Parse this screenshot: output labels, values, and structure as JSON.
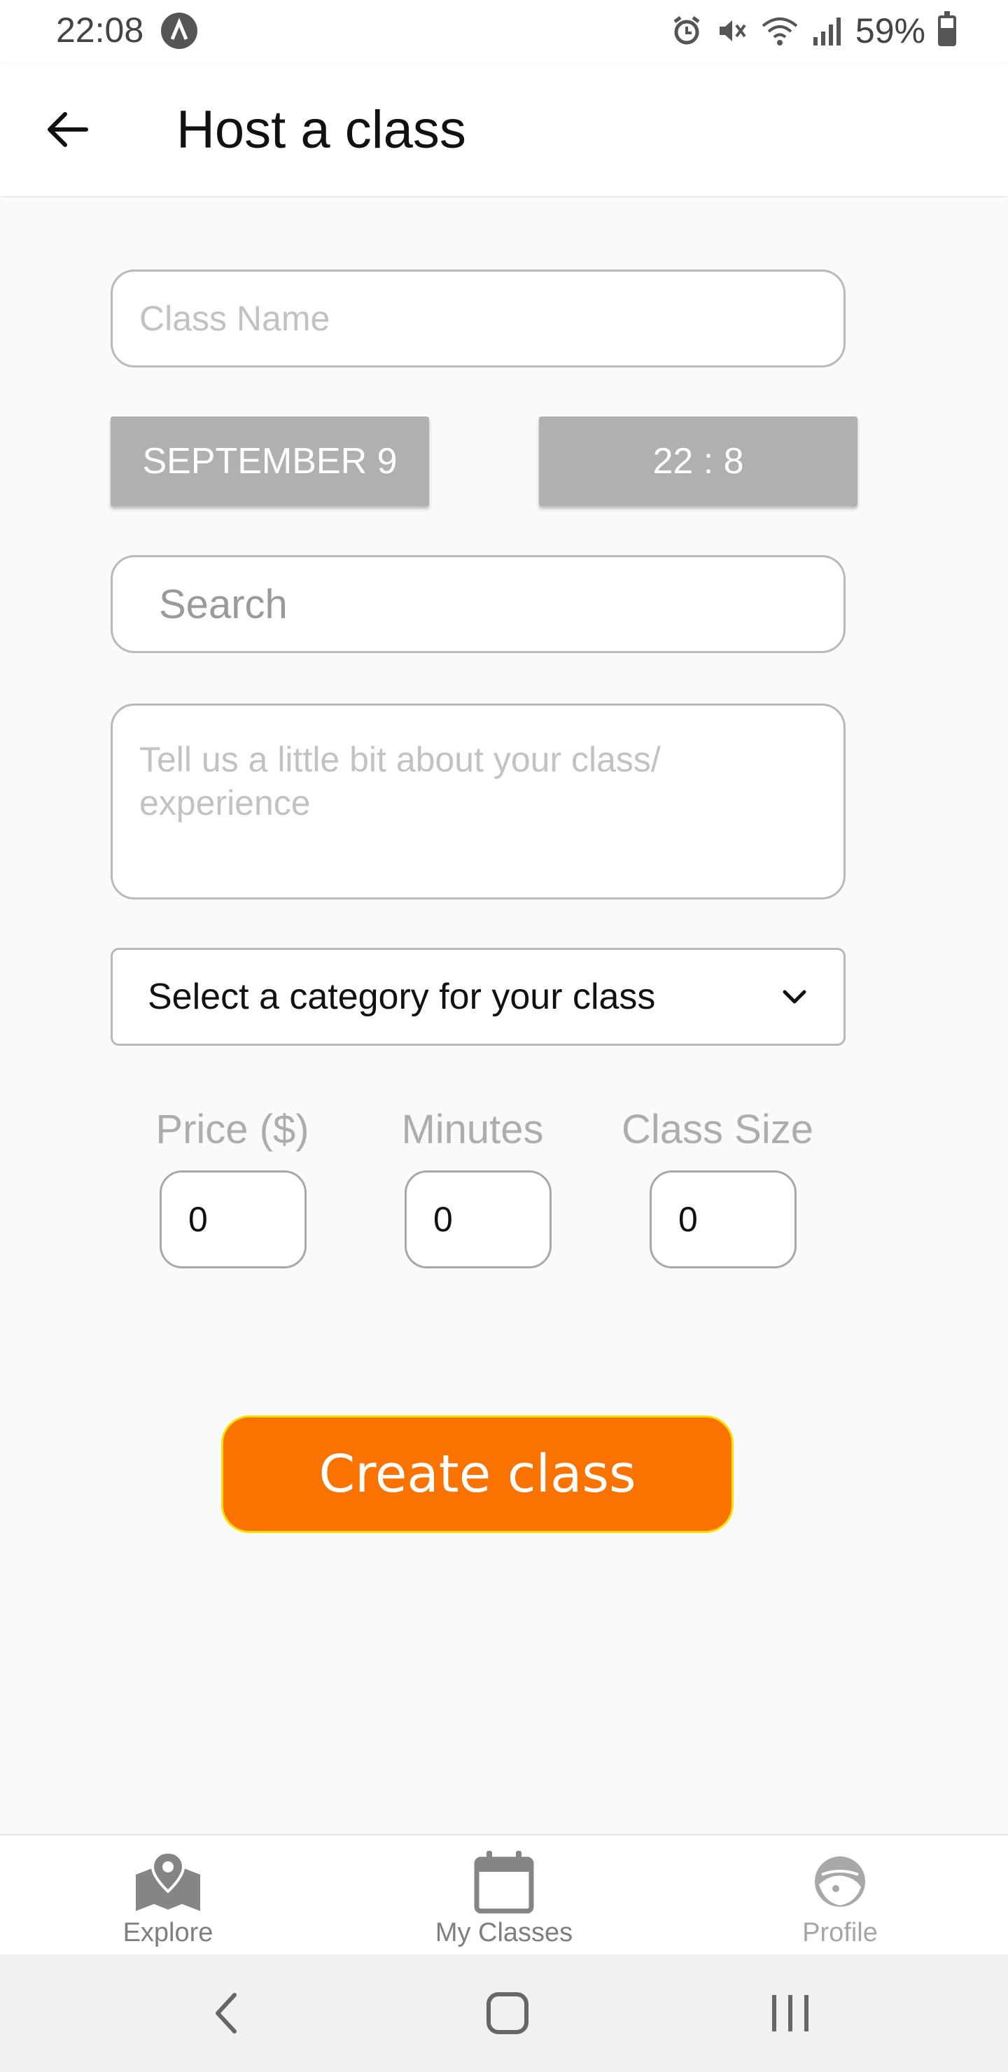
{
  "status_bar": {
    "time": "22:08",
    "battery": "59%"
  },
  "header": {
    "title": "Host a class"
  },
  "form": {
    "class_name_placeholder": "Class Name",
    "date_label": "SEPTEMBER 9",
    "time_label": "22 : 8",
    "search_placeholder": "Search",
    "about_placeholder": "Tell us a little bit about your class/ experience",
    "category_label": "Select a category for your class",
    "price_label": "Price ($)",
    "price_value": "0",
    "minutes_label": "Minutes",
    "minutes_value": "0",
    "size_label": "Class Size",
    "size_value": "0",
    "submit_label": "Create class"
  },
  "tabs": [
    {
      "label": "Explore",
      "icon": "map-pin-icon"
    },
    {
      "label": "My Classes",
      "icon": "calendar-icon"
    },
    {
      "label": "Profile",
      "icon": "profile-icon"
    }
  ],
  "colors": {
    "accent": "#fa7300",
    "accent_border": "#f5e100",
    "picker_bg": "#b0b0b0"
  }
}
